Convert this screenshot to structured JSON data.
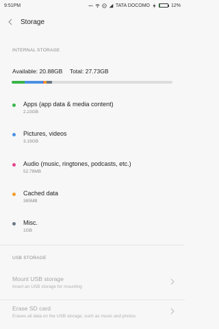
{
  "status_bar": {
    "time": "9:51PM",
    "carrier": "TATA DOCOMO",
    "battery": "12%",
    "battery_level": 0.12
  },
  "header": {
    "title": "Storage"
  },
  "internal": {
    "section_title": "INTERNAL STORAGE",
    "available_label": "Available: 20.88GB",
    "total_label": "Total: 27.73GB",
    "bar_total_gb": 27.73,
    "segments": [
      {
        "name": "apps",
        "gb": 2.23,
        "color": "#39b54a"
      },
      {
        "name": "pictures",
        "gb": 3.19,
        "color": "#4a90e2"
      },
      {
        "name": "audio",
        "gb": 0.053,
        "color": "#e8438f"
      },
      {
        "name": "cached",
        "gb": 0.385,
        "color": "#f39c2b"
      },
      {
        "name": "misc",
        "gb": 1.0,
        "color": "#6b7785"
      }
    ],
    "items": [
      {
        "label": "Apps (app data & media content)",
        "size": "2.23GB",
        "color": "#39b54a"
      },
      {
        "label": "Pictures, videos",
        "size": "3.19GB",
        "color": "#4a90e2"
      },
      {
        "label": "Audio (music, ringtones, podcasts, etc.)",
        "size": "52.78MB",
        "color": "#e8438f"
      },
      {
        "label": "Cached data",
        "size": "385MB",
        "color": "#f39c2b"
      },
      {
        "label": "Misc.",
        "size": "1GB",
        "color": "#6b7785"
      }
    ]
  },
  "usb": {
    "section_title": "USB STORAGE",
    "items": [
      {
        "label": "Mount USB storage",
        "desc": "Insert an USB storage for mounting"
      },
      {
        "label": "Erase SD card",
        "desc": "Erases all data on the USB storage, such as music and photos"
      }
    ]
  }
}
